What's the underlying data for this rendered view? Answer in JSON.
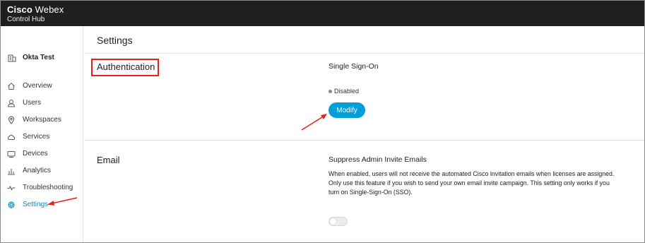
{
  "header": {
    "brand_bold": "Cisco",
    "brand_light": "Webex",
    "product": "Control Hub"
  },
  "sidebar": {
    "org_name": "Okta Test",
    "org_icon": "building-icon",
    "items": [
      {
        "label": "Overview",
        "icon": "home-icon"
      },
      {
        "label": "Users",
        "icon": "user-icon"
      },
      {
        "label": "Workspaces",
        "icon": "location-pin-icon"
      },
      {
        "label": "Services",
        "icon": "cloud-icon"
      },
      {
        "label": "Devices",
        "icon": "device-icon"
      },
      {
        "label": "Analytics",
        "icon": "bar-chart-icon"
      },
      {
        "label": "Troubleshooting",
        "icon": "pulse-icon"
      },
      {
        "label": "Settings",
        "icon": "gear-icon",
        "active": true
      }
    ]
  },
  "main": {
    "title": "Settings",
    "authentication": {
      "title": "Authentication",
      "field_title": "Single Sign-On",
      "status": "Disabled",
      "button": "Modify"
    },
    "email": {
      "title": "Email",
      "field_title": "Suppress Admin Invite Emails",
      "description": "When enabled, users will not receive the automated Cisco invitation emails when licenses are assigned. Only use this feature if you wish to send your own email invite campaign. This setting only works if you turn on Single-Sign-On (SSO).",
      "toggle_on": false
    }
  },
  "colors": {
    "topbar": "#1f1f1f",
    "accent": "#049fd9",
    "active_nav": "#0a8bc4",
    "annotation_red": "#e2231a"
  }
}
